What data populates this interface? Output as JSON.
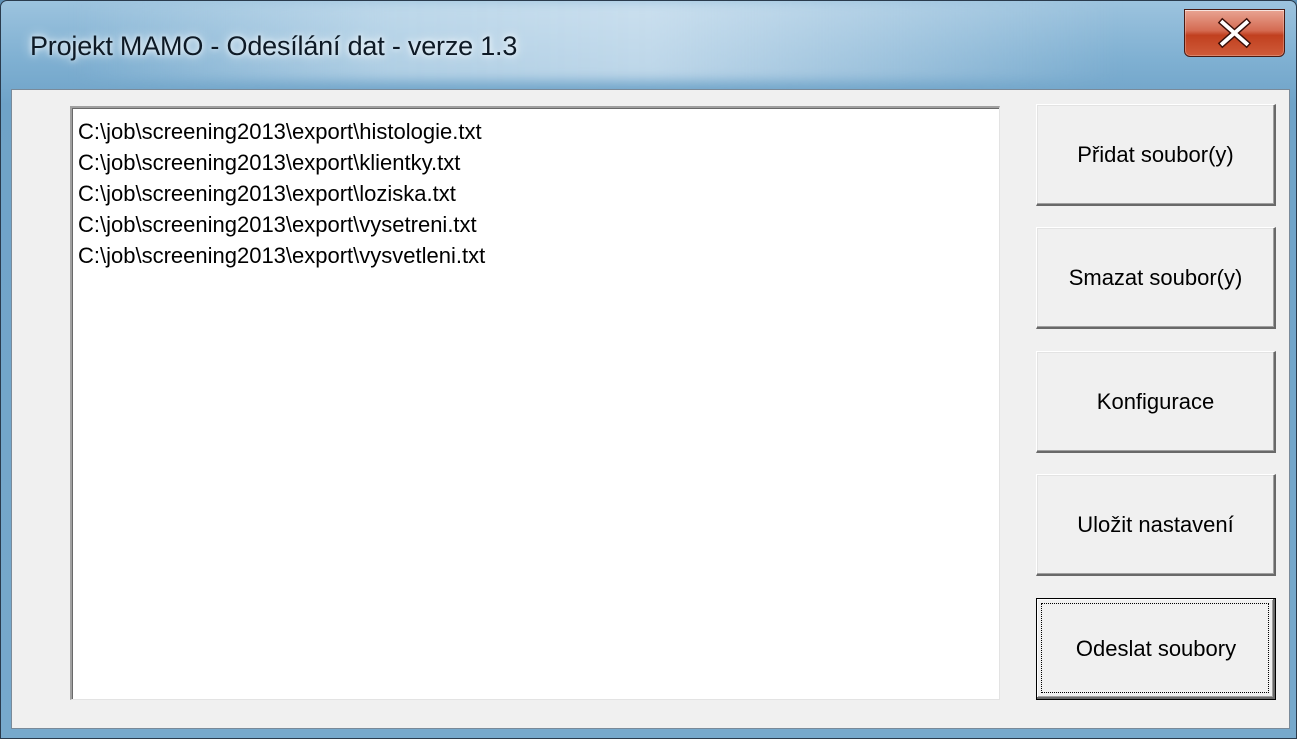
{
  "window": {
    "title": "Projekt MAMO - Odesílání dat - verze 1.3",
    "close_glyph": "X"
  },
  "file_list": {
    "items": [
      "C:\\job\\screening2013\\export\\histologie.txt",
      "C:\\job\\screening2013\\export\\klientky.txt",
      "C:\\job\\screening2013\\export\\loziska.txt",
      "C:\\job\\screening2013\\export\\vysetreni.txt",
      "C:\\job\\screening2013\\export\\vysvetleni.txt"
    ]
  },
  "buttons": {
    "add_files": "Přidat soubor(y)",
    "delete_files": "Smazat soubor(y)",
    "configuration": "Konfigurace",
    "save_settings": "Uložit nastavení",
    "send_files": "Odeslat soubory"
  },
  "colors": {
    "close_button": "#c9503a",
    "client_background": "#f0f0f0",
    "title_frame": "#7fb0d2"
  }
}
